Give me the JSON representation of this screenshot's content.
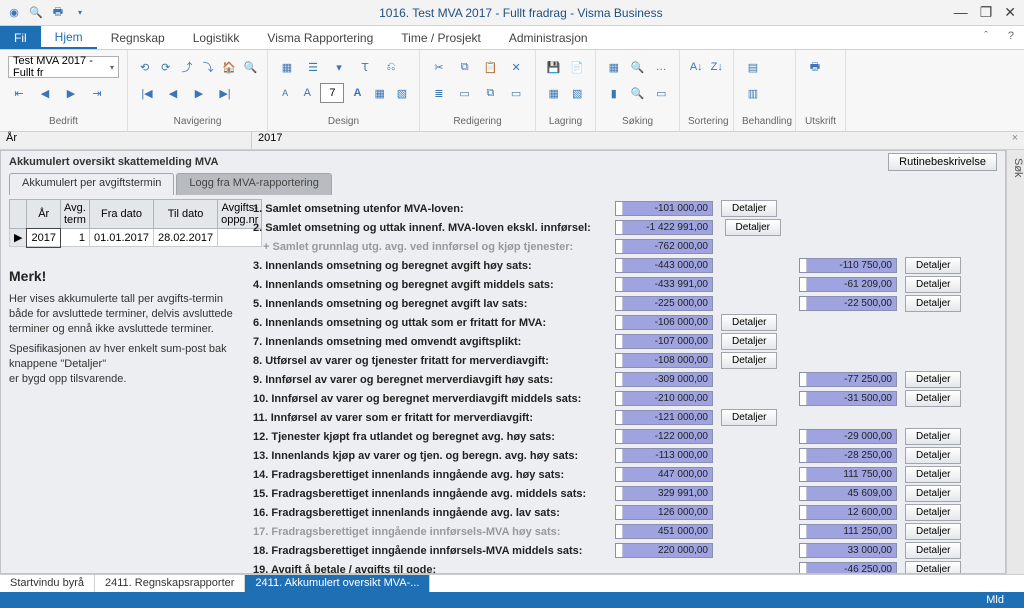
{
  "window": {
    "title": "1016. Test MVA 2017 - Fullt fradrag -  Visma Business"
  },
  "menutabs": {
    "file": "Fil",
    "items": [
      "Hjem",
      "Regnskap",
      "Logistikk",
      "Visma Rapportering",
      "Time / Prosjekt",
      "Administrasjon"
    ],
    "activeIndex": 0
  },
  "ribbon": {
    "company_combo": "Test MVA 2017 - Fullt fr",
    "fontsize": "7",
    "groups": [
      "Bedrift",
      "Navigering",
      "Design",
      "Redigering",
      "Lagring",
      "Søking",
      "Sortering",
      "Behandling",
      "Utskrift"
    ]
  },
  "addr": {
    "label": "År",
    "value": "2017"
  },
  "panel": {
    "title": "Akkumulert oversikt skattemelding MVA",
    "rutine_btn": "Rutinebeskrivelse",
    "subtabs": [
      "Akkumulert per avgiftstermin",
      "Logg fra MVA-rapportering"
    ],
    "subtab_active": 0
  },
  "table": {
    "headers": [
      "År",
      "Avg. term",
      "Fra dato",
      "Til dato",
      "Avgifts-oppg.nr"
    ],
    "row": {
      "ar": "2017",
      "term": "1",
      "fra": "01.01.2017",
      "til": "28.02.2017",
      "oppg": ""
    }
  },
  "note": {
    "heading": "Merk!",
    "p1": "Her vises akkumulerte tall per avgifts-termin både for avsluttede terminer, delvis avsluttede terminer og ennå ikke avsluttede terminer.",
    "p2": "Spesifikasjonen av hver enkelt sum-post bak knappene \"Detaljer\"",
    "p3": "er bygd opp tilsvarende."
  },
  "detaljer_label": "Detaljer",
  "rows": [
    {
      "no": "1.",
      "label": "Samlet omsetning utenfor MVA-loven:",
      "v1": "-101 000,00",
      "det1": true
    },
    {
      "no": "2.",
      "label": "Samlet omsetning og uttak innenf. MVA-loven ekskl. innførsel:",
      "v1": "-1 422 991,00",
      "det1": true,
      "det1_offset": true
    },
    {
      "no": "+",
      "label": "Samlet grunnlag utg. avg. ved innførsel og kjøp tjenester:",
      "v1": "-762 000,00",
      "dim": true
    },
    {
      "no": "3.",
      "label": "Innenlands omsetning og beregnet avgift høy sats:",
      "v1": "-443 000,00",
      "v2": "-110 750,00",
      "det2": true
    },
    {
      "no": "4.",
      "label": "Innenlands omsetning og beregnet avgift middels sats:",
      "v1": "-433 991,00",
      "v2": "-61 209,00",
      "det2": true
    },
    {
      "no": "5.",
      "label": "Innenlands omsetning og beregnet avgift lav sats:",
      "v1": "-225 000,00",
      "v2": "-22 500,00",
      "det2": true
    },
    {
      "no": "6.",
      "label": "Innenlands omsetning og uttak som er fritatt for MVA:",
      "v1": "-106 000,00",
      "det1": true
    },
    {
      "no": "7.",
      "label": "Innenlands omsetning med omvendt avgiftsplikt:",
      "v1": "-107 000,00",
      "det1": true
    },
    {
      "no": "8.",
      "label": "Utførsel av varer og tjenester fritatt for merverdiavgift:",
      "v1": "-108 000,00",
      "det1": true
    },
    {
      "no": "9.",
      "label": "Innførsel av varer og beregnet merverdiavgift høy sats:",
      "v1": "-309 000,00",
      "v2": "-77 250,00",
      "det2": true
    },
    {
      "no": "10.",
      "label": "Innførsel av varer og beregnet merverdiavgift middels sats:",
      "v1": "-210 000,00",
      "v2": "-31 500,00",
      "det2": true
    },
    {
      "no": "11.",
      "label": "Innførsel av varer som er fritatt for merverdiavgift:",
      "v1": "-121 000,00",
      "det1": true
    },
    {
      "no": "12.",
      "label": "Tjenester kjøpt fra utlandet og beregnet avg. høy sats:",
      "v1": "-122 000,00",
      "v2": "-29 000,00",
      "det2": true
    },
    {
      "no": "13.",
      "label": "Innenlands kjøp av varer og tjen. og beregn. avg. høy sats:",
      "v1": "-113 000,00",
      "v2": "-28 250,00",
      "det2": true
    },
    {
      "no": "14.",
      "label": "Fradragsberettiget innenlands inngående avg. høy sats:",
      "v1": "447 000,00",
      "v2": "111 750,00",
      "det2": true
    },
    {
      "no": "15.",
      "label": "Fradragsberettiget innenlands inngående avg. middels sats:",
      "v1": "329 991,00",
      "v2": "45 609,00",
      "det2": true
    },
    {
      "no": "16.",
      "label": "Fradragsberettiget innenlands inngående avg. lav sats:",
      "v1": "126 000,00",
      "v2": "12 600,00",
      "det2": true
    },
    {
      "no": "17.",
      "label": "Fradragsberettiget inngående innførsels-MVA høy  sats:",
      "v1": "451 000,00",
      "v2": "111 250,00",
      "det2": true,
      "dim": true
    },
    {
      "no": "18.",
      "label": "Fradragsberettiget inngående innførsels-MVA middels sats:",
      "v1": "220 000,00",
      "v2": "33 000,00",
      "det2": true
    },
    {
      "no": "19.",
      "label": "Avgift å betale / avgifts til gode:",
      "v2": "-46 250,00",
      "det2": true
    }
  ],
  "bottomtabs": {
    "items": [
      "Startvindu byrå",
      "2411. Regnskapsrapporter",
      "2411. Akkumulert oversikt MVA-..."
    ],
    "activeIndex": 2
  },
  "status": "Mld",
  "search_label": "Søk"
}
